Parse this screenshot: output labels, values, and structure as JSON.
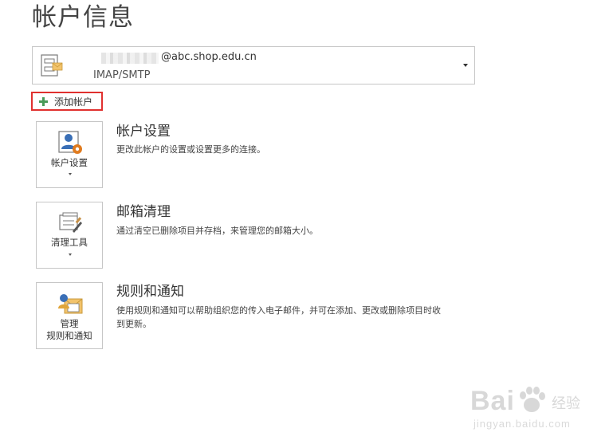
{
  "page": {
    "title": "帐户信息"
  },
  "account": {
    "email_suffix": "@abc.shop.edu.cn",
    "type": "IMAP/SMTP"
  },
  "add_account": {
    "label": "添加帐户"
  },
  "sections": [
    {
      "button_label": "帐户设置",
      "title": "帐户设置",
      "description": "更改此帐户的设置或设置更多的连接。",
      "icon": "account-settings-icon"
    },
    {
      "button_label": "清理工具",
      "title": "邮箱清理",
      "description": "通过清空已删除项目并存档，来管理您的邮箱大小。",
      "icon": "cleanup-tools-icon"
    },
    {
      "button_label_line1": "管理",
      "button_label_line2": "规则和通知",
      "title": "规则和通知",
      "description_line1": "使用规则和通知可以帮助组织您的传入电子邮件，并可在添加、更改或删除项目时收",
      "description_line2": "到更新。",
      "icon": "rules-alerts-icon"
    }
  ],
  "watermark": {
    "main": "Bai",
    "cn": "经验",
    "sub": "jingyan.baidu.com"
  }
}
